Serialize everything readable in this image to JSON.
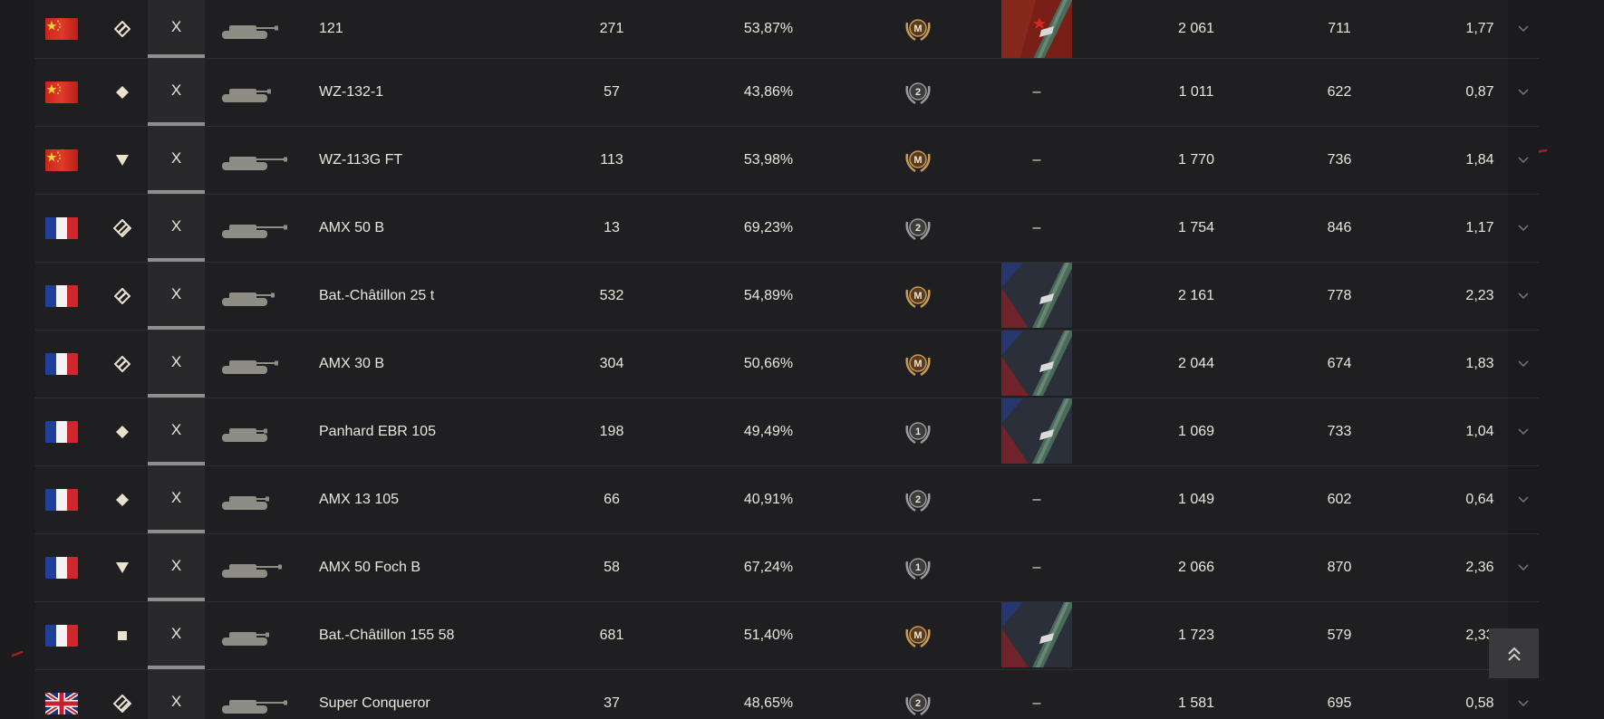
{
  "rows": [
    {
      "nation": "china",
      "type": "medium-tank-icon",
      "tier": "X",
      "name": "121",
      "battles": "271",
      "winrate": "53,87%",
      "mastery": "M",
      "camo": "china",
      "damage": "2 061",
      "xp": "711",
      "kd": "1,77"
    },
    {
      "nation": "china",
      "type": "light-tank-icon",
      "tier": "X",
      "name": "WZ-132-1",
      "battles": "57",
      "winrate": "43,86%",
      "mastery": "2",
      "camo": "–",
      "damage": "1 011",
      "xp": "622",
      "kd": "0,87"
    },
    {
      "nation": "china",
      "type": "td-icon",
      "tier": "X",
      "name": "WZ-113G FT",
      "battles": "113",
      "winrate": "53,98%",
      "mastery": "M",
      "camo": "–",
      "damage": "1 770",
      "xp": "736",
      "kd": "1,84"
    },
    {
      "nation": "france",
      "type": "heavy-tank-icon",
      "tier": "X",
      "name": "AMX 50 B",
      "battles": "13",
      "winrate": "69,23%",
      "mastery": "2",
      "camo": "–",
      "damage": "1 754",
      "xp": "846",
      "kd": "1,17"
    },
    {
      "nation": "france",
      "type": "medium-tank-icon",
      "tier": "X",
      "name": "Bat.-Châtillon 25 t",
      "battles": "532",
      "winrate": "54,89%",
      "mastery": "M",
      "camo": "france",
      "damage": "2 161",
      "xp": "778",
      "kd": "2,23"
    },
    {
      "nation": "france",
      "type": "medium-tank-icon",
      "tier": "X",
      "name": "AMX 30 B",
      "battles": "304",
      "winrate": "50,66%",
      "mastery": "M",
      "camo": "france",
      "damage": "2 044",
      "xp": "674",
      "kd": "1,83"
    },
    {
      "nation": "france",
      "type": "light-tank-icon",
      "tier": "X",
      "name": "Panhard EBR 105",
      "battles": "198",
      "winrate": "49,49%",
      "mastery": "1",
      "camo": "france",
      "damage": "1 069",
      "xp": "733",
      "kd": "1,04"
    },
    {
      "nation": "france",
      "type": "light-tank-icon",
      "tier": "X",
      "name": "AMX 13 105",
      "battles": "66",
      "winrate": "40,91%",
      "mastery": "2",
      "camo": "–",
      "damage": "1 049",
      "xp": "602",
      "kd": "0,64"
    },
    {
      "nation": "france",
      "type": "td-icon",
      "tier": "X",
      "name": "AMX 50 Foch B",
      "battles": "58",
      "winrate": "67,24%",
      "mastery": "1",
      "camo": "–",
      "damage": "2 066",
      "xp": "870",
      "kd": "2,36"
    },
    {
      "nation": "france",
      "type": "spg-icon",
      "tier": "X",
      "name": "Bat.-Châtillon 155 58",
      "battles": "681",
      "winrate": "51,40%",
      "mastery": "M",
      "camo": "france",
      "damage": "1 723",
      "xp": "579",
      "kd": "2,33"
    },
    {
      "nation": "uk",
      "type": "heavy-tank-icon",
      "tier": "X",
      "name": "Super Conqueror",
      "battles": "37",
      "winrate": "48,65%",
      "mastery": "2",
      "camo": "–",
      "damage": "1 581",
      "xp": "695",
      "kd": "0,58"
    }
  ],
  "colors": {
    "accent_gold": "#c9a25c",
    "bg": "#1c1c1e",
    "text": "#e8e6dd"
  }
}
